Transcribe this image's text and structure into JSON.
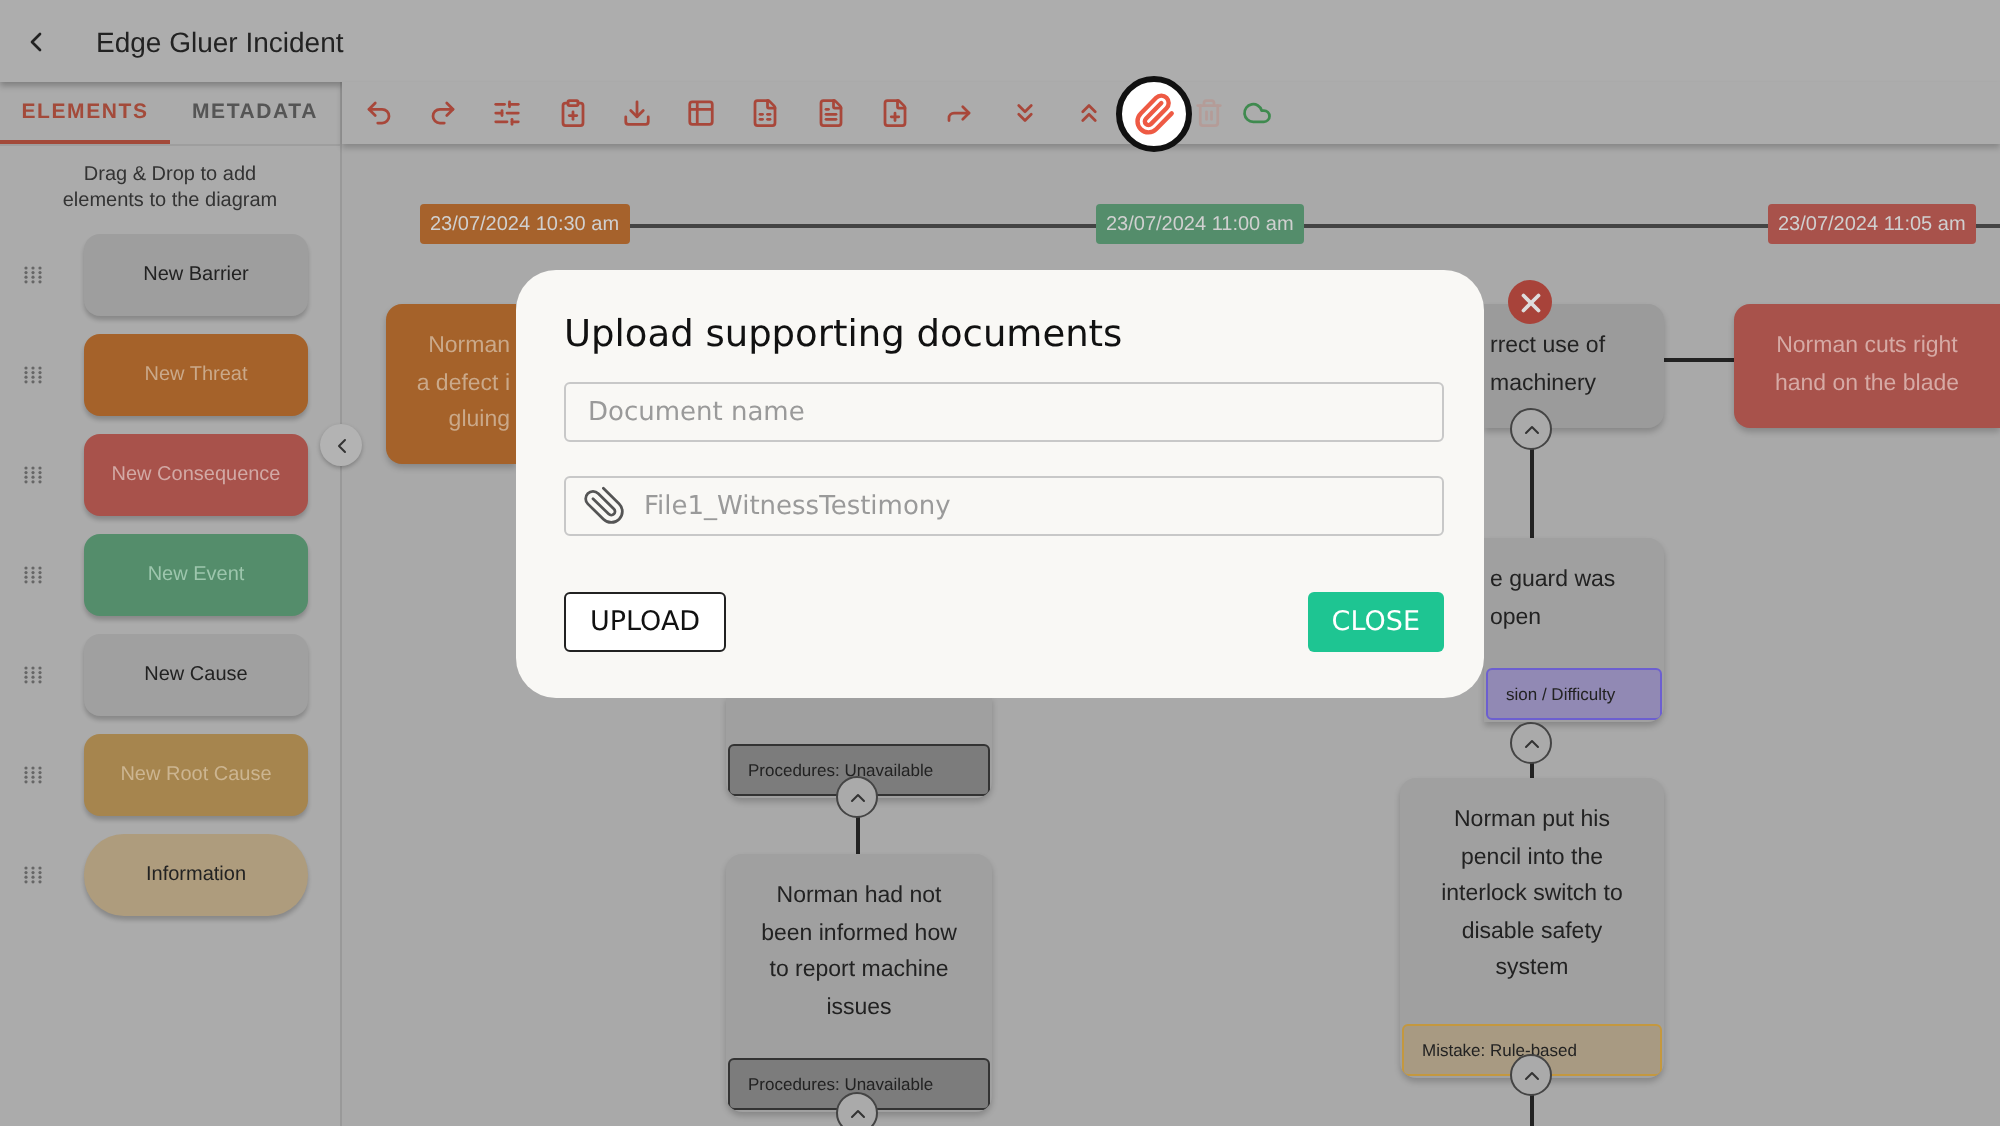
{
  "header": {
    "title": "Edge Gluer Incident"
  },
  "sidebar": {
    "tabs": [
      {
        "label": "ELEMENTS",
        "selected": true
      },
      {
        "label": "METADATA",
        "selected": false
      }
    ],
    "hint": "Drag & Drop to add elements to the diagram",
    "elements": [
      {
        "label": "New Barrier",
        "kind": "barrier"
      },
      {
        "label": "New Threat",
        "kind": "threat"
      },
      {
        "label": "New Consequence",
        "kind": "consequence"
      },
      {
        "label": "New Event",
        "kind": "event"
      },
      {
        "label": "New Cause",
        "kind": "cause"
      },
      {
        "label": "New Root Cause",
        "kind": "root"
      },
      {
        "label": "Information",
        "kind": "info"
      }
    ]
  },
  "toolbar": {
    "buttons": [
      {
        "kind": "undo",
        "highlighted": false,
        "disabled": false
      },
      {
        "kind": "redo",
        "highlighted": false,
        "disabled": false
      },
      {
        "kind": "sliders",
        "highlighted": false,
        "disabled": false
      },
      {
        "kind": "clipboard",
        "highlighted": false,
        "disabled": false
      },
      {
        "kind": "download",
        "highlighted": false,
        "disabled": false
      },
      {
        "kind": "table",
        "highlighted": false,
        "disabled": false
      },
      {
        "kind": "spreadsheet",
        "highlighted": false,
        "disabled": false
      },
      {
        "kind": "document",
        "highlighted": false,
        "disabled": false
      },
      {
        "kind": "add-note",
        "highlighted": false,
        "disabled": false
      },
      {
        "kind": "share",
        "highlighted": false,
        "disabled": false
      },
      {
        "kind": "collapse",
        "highlighted": false,
        "disabled": false
      },
      {
        "kind": "expand",
        "highlighted": false,
        "disabled": false
      },
      {
        "kind": "attach",
        "highlighted": true,
        "disabled": false
      },
      {
        "kind": "delete",
        "highlighted": false,
        "disabled": true
      },
      {
        "kind": "cloud",
        "highlighted": false,
        "disabled": false
      }
    ]
  },
  "canvas": {
    "timeline": [
      {
        "label": "23/07/2024 10:30 am",
        "color": "#a6622c"
      },
      {
        "label": "23/07/2024 11:00 am",
        "color": "#548d6b"
      },
      {
        "label": "23/07/2024 11:05 am",
        "color": "#a8524b"
      }
    ],
    "nodes": [
      {
        "kind": "threat",
        "text": "Norman\na defect i\ngluing"
      },
      {
        "kind": "cause",
        "tag": {
          "label": "Procedures: Unavailable",
          "kind": "procedures"
        }
      },
      {
        "kind": "cause",
        "text": "Norman had not been informed how to report machine issues",
        "tag": {
          "label": "Procedures: Unavailable",
          "kind": "procedures"
        }
      },
      {
        "kind": "barrier",
        "text": "rrect use of\nmachinery",
        "failed": true
      },
      {
        "kind": "cause",
        "text": "e guard was\nopen",
        "tag": {
          "label": "sion / Difficulty",
          "kind": "decision"
        }
      },
      {
        "kind": "cause",
        "text": "Norman put his pencil into the interlock switch to disable safety system",
        "tag": {
          "label": "Mistake: Rule-based",
          "kind": "mistake"
        }
      },
      {
        "kind": "consequence",
        "text": "Norman cuts right hand on the blade"
      }
    ]
  },
  "dialog": {
    "title": "Upload supporting documents",
    "name_field": {
      "placeholder": "Document name"
    },
    "file_field": {
      "file_name": "File1_WitnessTestimony"
    },
    "buttons": [
      {
        "label": "UPLOAD",
        "kind": "outline"
      },
      {
        "label": "CLOSE",
        "kind": "primary"
      }
    ]
  }
}
